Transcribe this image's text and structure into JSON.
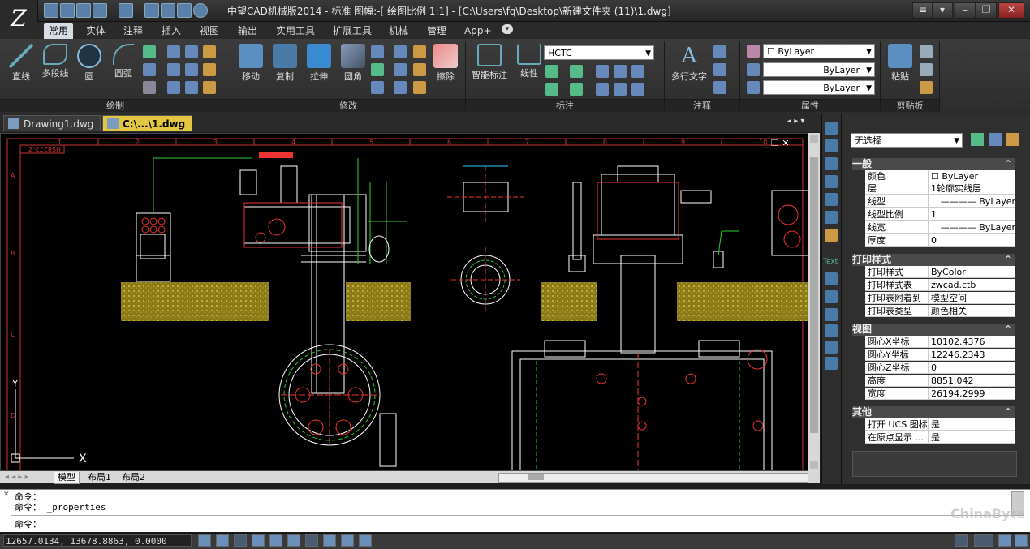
{
  "title_bar": {
    "title": "中望CAD机械版2014 -  标准 图幅:-[ 绘图比例 1:1] - [C:\\Users\\fq\\Desktop\\新建文件夹 (11)\\1.dwg]"
  },
  "ribbon_tabs": [
    "常用",
    "实体",
    "注释",
    "插入",
    "视图",
    "输出",
    "实用工具",
    "扩展工具",
    "机械",
    "管理",
    "App+"
  ],
  "ribbon_panels": {
    "draw": {
      "label": "绘制",
      "buttons": [
        "直线",
        "多段线",
        "圆",
        "圆弧"
      ]
    },
    "modify": {
      "label": "修改",
      "buttons": [
        "移动",
        "复制",
        "拉伸",
        "圆角",
        "擦除"
      ]
    },
    "dimension": {
      "label": "标注",
      "buttons": [
        "智能标注",
        "线性"
      ],
      "style_combo": "HCTC"
    },
    "annotation": {
      "label": "注释",
      "buttons": [
        "多行文字"
      ]
    },
    "properties": {
      "label": "属性",
      "color": "ByLayer",
      "linetype": "ByLayer",
      "lineweight": "ByLayer"
    },
    "clipboard": {
      "label": "剪贴板",
      "buttons": [
        "粘贴"
      ]
    }
  },
  "doc_tabs": [
    {
      "label": "Drawing1.dwg",
      "active": false
    },
    {
      "label": "C:\\...\\1.dwg",
      "active": true
    }
  ],
  "layout_tabs": [
    "模型",
    "布局1",
    "布局2"
  ],
  "properties_panel": {
    "selection": "无选择",
    "groups": [
      {
        "name": "一般",
        "rows": [
          [
            "颜色",
            "ByLayer"
          ],
          [
            "层",
            "1轮廓实线层"
          ],
          [
            "线型",
            "ByLayer"
          ],
          [
            "线型比例",
            "1"
          ],
          [
            "线宽",
            "ByLayer"
          ],
          [
            "厚度",
            "0"
          ]
        ]
      },
      {
        "name": "打印样式",
        "rows": [
          [
            "打印样式",
            "ByColor"
          ],
          [
            "打印样式表",
            "zwcad.ctb"
          ],
          [
            "打印表附着到",
            "模型空间"
          ],
          [
            "打印表类型",
            "颜色相关"
          ]
        ]
      },
      {
        "name": "视图",
        "rows": [
          [
            "圆心X坐标",
            "10102.4376"
          ],
          [
            "圆心Y坐标",
            "12246.2343"
          ],
          [
            "圆心Z坐标",
            "0"
          ],
          [
            "高度",
            "8851.042"
          ],
          [
            "宽度",
            "26194.2999"
          ]
        ]
      },
      {
        "name": "其他",
        "rows": [
          [
            "打开 UCS 图标",
            "是"
          ],
          [
            "在原点显示 ...",
            "是"
          ]
        ]
      }
    ]
  },
  "command": {
    "lines": [
      "命令：",
      "命令： _properties",
      "命令："
    ]
  },
  "status": {
    "coordinates": "12657.0134,  13678.8863,  0.0000"
  },
  "canvas": {
    "axis_x": "X",
    "axis_y": "Y",
    "title_block": "HS8273-Z",
    "ruler_numbers": [
      "1",
      "2",
      "3",
      "4",
      "5",
      "6",
      "7",
      "8",
      "9",
      "10"
    ],
    "side_letters": [
      "A",
      "B",
      "C",
      "D"
    ]
  },
  "watermark": "ChinaByte",
  "colors": {
    "accent": "#d9c26a",
    "drawing_bg": "#000000",
    "hatch": "#c8b432"
  }
}
